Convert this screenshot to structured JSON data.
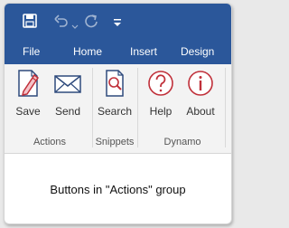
{
  "colors": {
    "accent": "#2b579a",
    "icon_red": "#c0303a",
    "icon_navy": "#2e4a7c",
    "ribbon_bg": "#f3f3f3"
  },
  "qat": {
    "icons": [
      "save-icon",
      "undo-icon",
      "redo-icon",
      "customize-dropdown-icon"
    ]
  },
  "tabs": [
    {
      "label": "File"
    },
    {
      "label": "Home"
    },
    {
      "label": "Insert"
    },
    {
      "label": "Design"
    }
  ],
  "groups": [
    {
      "label": "Actions",
      "buttons": [
        {
          "label": "Save",
          "icon": "save-document-icon"
        },
        {
          "label": "Send",
          "icon": "envelope-icon"
        }
      ]
    },
    {
      "label": "Snippets",
      "buttons": [
        {
          "label": "Search",
          "icon": "search-document-icon"
        }
      ]
    },
    {
      "label": "Dynamo",
      "buttons": [
        {
          "label": "Help",
          "icon": "question-icon"
        },
        {
          "label": "About",
          "icon": "info-icon"
        }
      ]
    }
  ],
  "caption": "Buttons in \"Actions\" group"
}
